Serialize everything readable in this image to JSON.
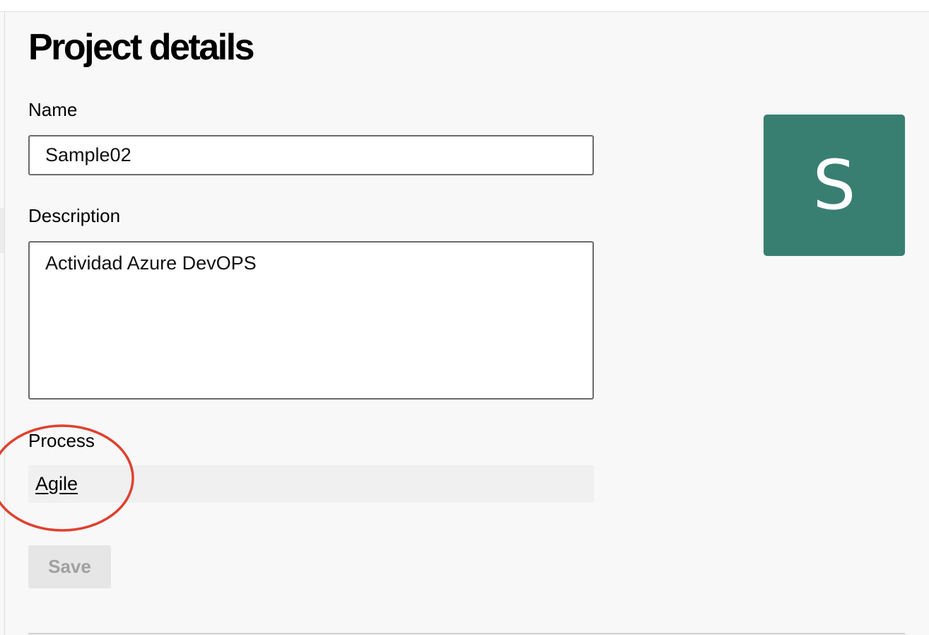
{
  "page": {
    "title": "Project details"
  },
  "form": {
    "name_label": "Name",
    "name_value": "Sample02",
    "description_label": "Description",
    "description_value": "Actividad Azure DevOPS",
    "process_label": "Process",
    "process_value": "Agile",
    "save_label": "Save"
  },
  "avatar": {
    "initial": "S",
    "color": "#387f72"
  },
  "annotation": {
    "color": "#e0402e",
    "target": "process"
  }
}
